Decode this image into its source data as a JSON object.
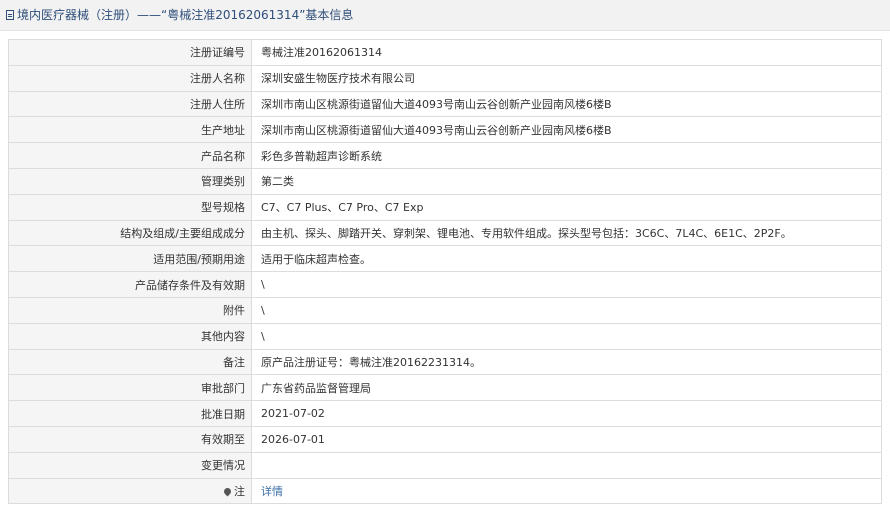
{
  "header": {
    "title": "境内医疗器械（注册）——“粤械注准20162061314”基本信息"
  },
  "rows": [
    {
      "label": "注册证编号",
      "value": "粤械注准20162061314"
    },
    {
      "label": "注册人名称",
      "value": "深圳安盛生物医疗技术有限公司"
    },
    {
      "label": "注册人住所",
      "value": "深圳市南山区桃源街道留仙大道4093号南山云谷创新产业园南风楼6楼B"
    },
    {
      "label": "生产地址",
      "value": "深圳市南山区桃源街道留仙大道4093号南山云谷创新产业园南风楼6楼B"
    },
    {
      "label": "产品名称",
      "value": "彩色多普勒超声诊断系统"
    },
    {
      "label": "管理类别",
      "value": "第二类"
    },
    {
      "label": "型号规格",
      "value": "C7、C7 Plus、C7 Pro、C7 Exp"
    },
    {
      "label": "结构及组成/主要组成成分",
      "value": "由主机、探头、脚踏开关、穿刺架、锂电池、专用软件组成。探头型号包括：3C6C、7L4C、6E1C、2P2F。"
    },
    {
      "label": "适用范围/预期用途",
      "value": "适用于临床超声检查。"
    },
    {
      "label": "产品储存条件及有效期",
      "value": "\\"
    },
    {
      "label": "附件",
      "value": "\\"
    },
    {
      "label": "其他内容",
      "value": "\\"
    },
    {
      "label": "备注",
      "value": "原产品注册证号：粤械注准20162231314。"
    },
    {
      "label": "审批部门",
      "value": "广东省药品监督管理局"
    },
    {
      "label": "批准日期",
      "value": "2021-07-02"
    },
    {
      "label": "有效期至",
      "value": "2026-07-01"
    },
    {
      "label": "变更情况",
      "value": ""
    }
  ],
  "note": {
    "label": "注",
    "icon": "pin-icon",
    "link_text": "详情"
  }
}
